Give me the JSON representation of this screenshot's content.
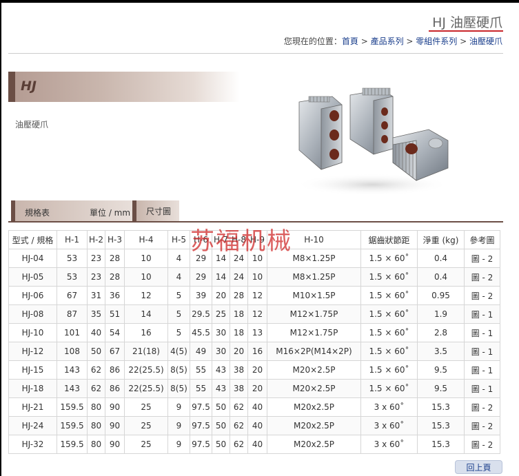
{
  "header": {
    "title": "HJ 油壓硬爪",
    "breadcrumb": {
      "prefix": "您現在的位置：",
      "home": "首頁",
      "sep": " > ",
      "products": "產品系列",
      "parts": "零組件系列",
      "current": "油壓硬爪"
    }
  },
  "product": {
    "model_band": "HJ",
    "subtitle": "油壓硬爪",
    "image_icon": "product-jaws-image"
  },
  "tabs": [
    {
      "label": "規格表",
      "unit": "單位 / mm"
    },
    {
      "label": "尺寸圖"
    }
  ],
  "watermark": "苏福机械",
  "table": {
    "headers": [
      "型式 / 規格",
      "H-1",
      "H-2",
      "H-3",
      "H-4",
      "H-5",
      "H-6",
      "H-7",
      "H-8",
      "H-9",
      "H-10",
      "鋸齒狀節距",
      "淨重 (kg)",
      "參考圖"
    ],
    "rows": [
      [
        "HJ-04",
        "53",
        "23",
        "28",
        "10",
        "4",
        "29",
        "14",
        "24",
        "10",
        "M8×1.25P",
        "1.5 × 60˚",
        "0.4",
        "圖 - 2"
      ],
      [
        "HJ-05",
        "53",
        "23",
        "28",
        "10",
        "4",
        "29",
        "14",
        "24",
        "10",
        "M8×1.25P",
        "1.5 × 60˚",
        "0.4",
        "圖 - 2"
      ],
      [
        "HJ-06",
        "67",
        "31",
        "36",
        "12",
        "5",
        "39",
        "20",
        "28",
        "12",
        "M10×1.5P",
        "1.5 × 60˚",
        "0.95",
        "圖 - 2"
      ],
      [
        "HJ-08",
        "87",
        "35",
        "51",
        "14",
        "5",
        "29.5",
        "25",
        "18",
        "12",
        "M12×1.75P",
        "1.5 × 60˚",
        "1.9",
        "圖 - 1"
      ],
      [
        "HJ-10",
        "101",
        "40",
        "54",
        "16",
        "5",
        "45.5",
        "30",
        "18",
        "13",
        "M12×1.75P",
        "1.5 × 60˚",
        "2.8",
        "圖 - 1"
      ],
      [
        "HJ-12",
        "108",
        "50",
        "67",
        "21(18)",
        "4(5)",
        "49",
        "30",
        "20",
        "16",
        "M16×2P(M14×2P)",
        "1.5 × 60˚",
        "3.5",
        "圖 - 1"
      ],
      [
        "HJ-15",
        "143",
        "62",
        "86",
        "22(25.5)",
        "8(5)",
        "55",
        "43",
        "38",
        "20",
        "M20×2.5P",
        "1.5 × 60˚",
        "9.5",
        "圖 - 1"
      ],
      [
        "HJ-18",
        "143",
        "62",
        "86",
        "22(25.5)",
        "8(5)",
        "55",
        "43",
        "38",
        "20",
        "M20×2.5P",
        "1.5 × 60˚",
        "9.5",
        "圖 - 1"
      ],
      [
        "HJ-21",
        "159.5",
        "80",
        "90",
        "25",
        "9",
        "97.5",
        "50",
        "62",
        "40",
        "M20x2.5P",
        "3 x 60˚",
        "15.3",
        "圖 - 2"
      ],
      [
        "HJ-24",
        "159.5",
        "80",
        "90",
        "25",
        "9",
        "97.5",
        "50",
        "62",
        "40",
        "M20x2.5P",
        "3 x 60˚",
        "15.3",
        "圖 - 2"
      ],
      [
        "HJ-32",
        "159.5",
        "80",
        "90",
        "25",
        "9",
        "97.5",
        "50",
        "62",
        "40",
        "M20x2.5P",
        "3 x 60˚",
        "15.3",
        "圖 - 2"
      ]
    ]
  },
  "footer": {
    "back_label": "回上頁"
  }
}
